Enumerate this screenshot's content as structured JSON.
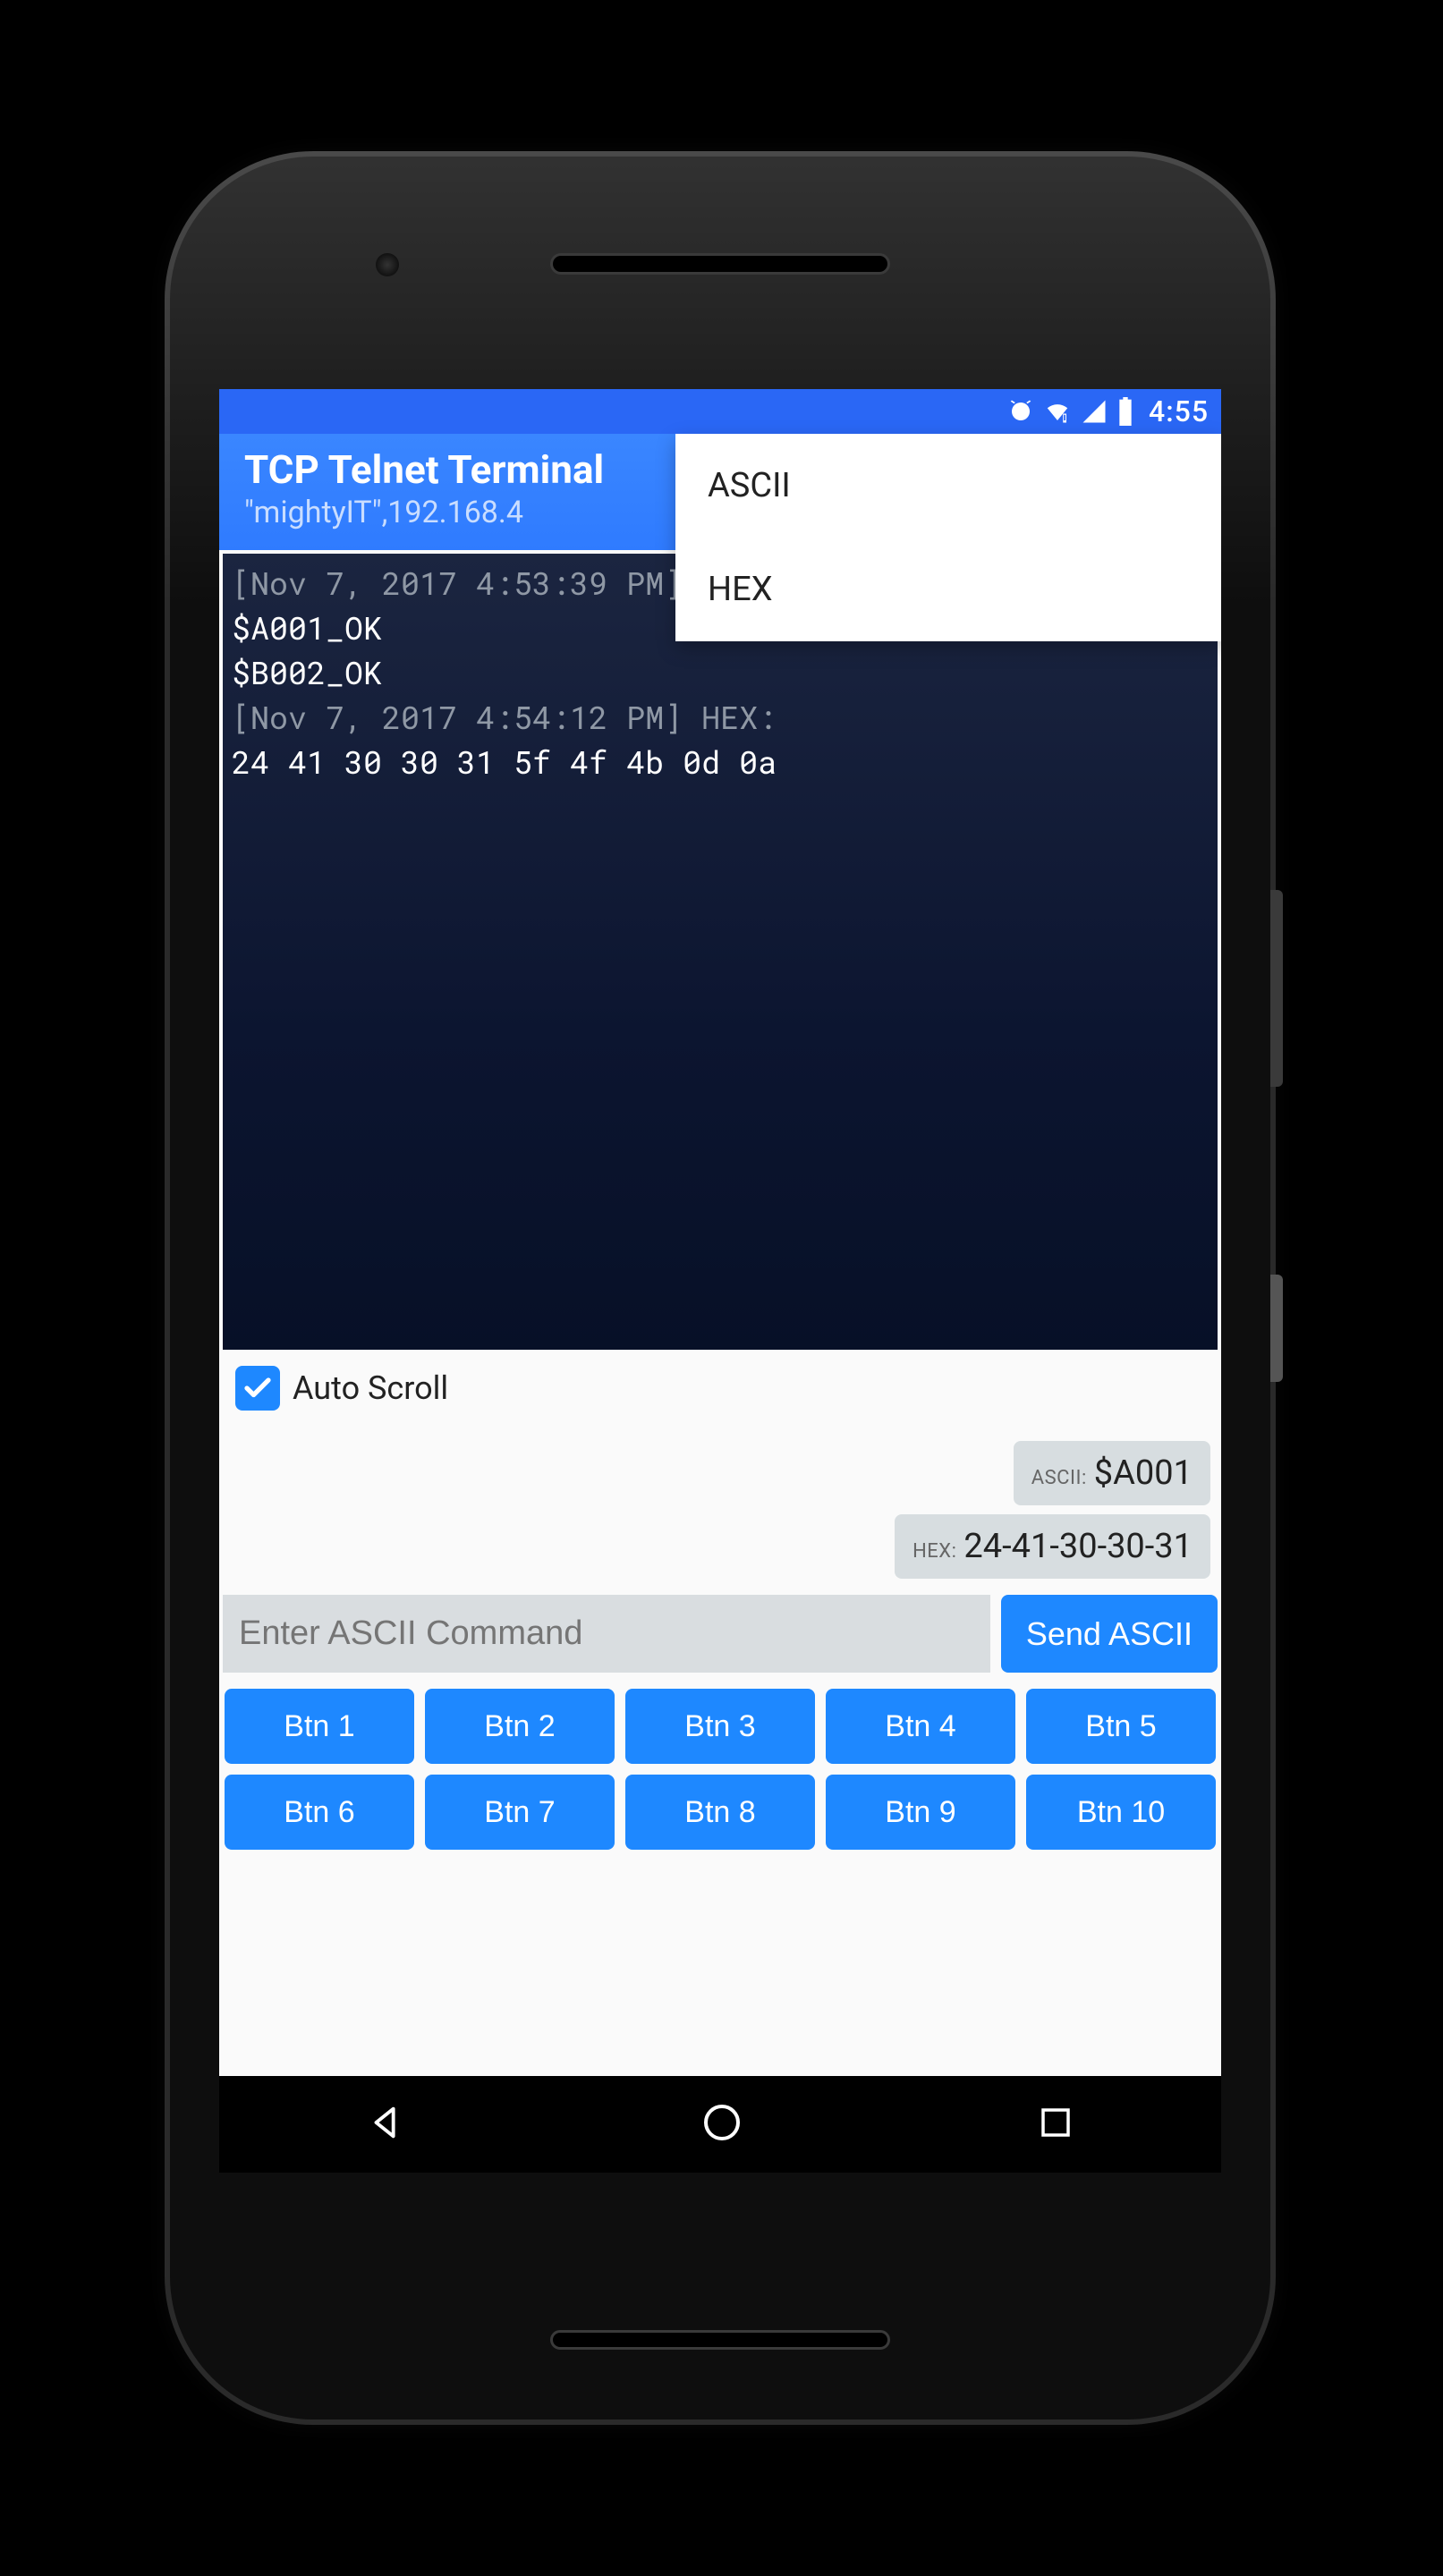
{
  "statusbar": {
    "time": "4:55"
  },
  "appbar": {
    "title": "TCP Telnet Terminal",
    "subtitle": "\"mightyIT\",192.168.4"
  },
  "menu": {
    "items": [
      {
        "label": "ASCII"
      },
      {
        "label": "HEX"
      }
    ]
  },
  "terminal": {
    "lines": [
      {
        "meta": "[Nov 7, 2017 4:53:39 PM]",
        "text": ""
      },
      {
        "meta": "",
        "text": "$A001_OK"
      },
      {
        "meta": "",
        "text": "$B002_OK"
      },
      {
        "meta": "[Nov 7, 2017 4:54:12 PM] HEX:",
        "text": ""
      },
      {
        "meta": "",
        "text": "24 41 30 30 31 5f 4f 4b 0d 0a"
      }
    ]
  },
  "autoscroll": {
    "label": "Auto Scroll",
    "checked": true
  },
  "sent": [
    {
      "type": "ASCII:",
      "value": "$A001"
    },
    {
      "type": "HEX:",
      "value": "24-41-30-30-31"
    }
  ],
  "input": {
    "placeholder": "Enter ASCII Command",
    "send_label": "Send ASCII"
  },
  "quick_buttons": [
    "Btn 1",
    "Btn 2",
    "Btn 3",
    "Btn 4",
    "Btn 5",
    "Btn 6",
    "Btn 7",
    "Btn 8",
    "Btn 9",
    "Btn 10"
  ]
}
